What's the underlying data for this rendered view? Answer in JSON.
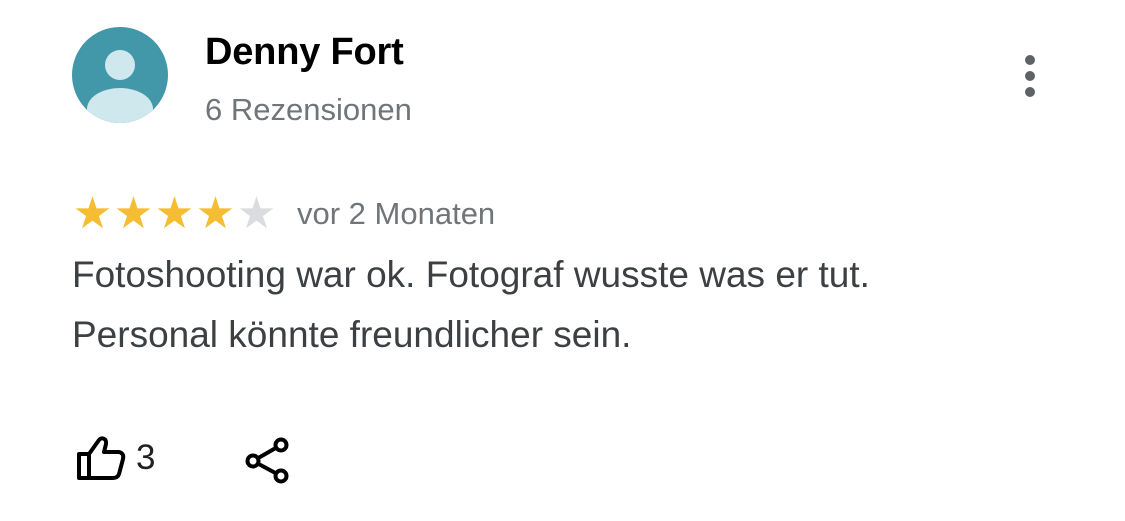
{
  "reviewer": {
    "name": "Denny Fort",
    "reviews_label": "6 Rezensionen",
    "avatar_icon": "person-icon",
    "avatar_color": "#4297a9"
  },
  "menu": {
    "icon": "more-vert-icon"
  },
  "rating": {
    "value": 4,
    "max": 5,
    "star_color": "#f5bd34",
    "empty_star_color": "#dadce0",
    "time_label": "vor 2 Monaten"
  },
  "review": {
    "text": "Fotoshooting war ok. Fotograf wusste was er tut. Personal könnte freundlicher sein."
  },
  "actions": {
    "like_icon": "thumb-up-icon",
    "like_count": "3",
    "share_icon": "share-icon"
  }
}
